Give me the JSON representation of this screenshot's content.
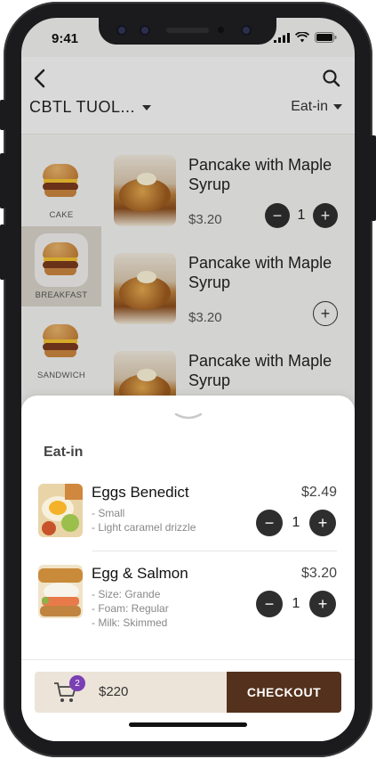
{
  "status": {
    "time": "9:41"
  },
  "header": {
    "store": "CBTL TUOL...",
    "mode": "Eat-in"
  },
  "categories": [
    {
      "label": "CAKE",
      "active": false
    },
    {
      "label": "BREAKFAST",
      "active": true
    },
    {
      "label": "SANDWICH",
      "active": false
    }
  ],
  "menu_items": [
    {
      "name": "Pancake with Maple Syrup",
      "price": "$3.20",
      "quantity": "1"
    },
    {
      "name": "Pancake with Maple Syrup",
      "price": "$3.20",
      "quantity": ""
    },
    {
      "name": "Pancake with Maple Syrup",
      "price": "",
      "quantity": ""
    }
  ],
  "sheet": {
    "title": "Eat-in",
    "items": [
      {
        "name": "Eggs Benedict",
        "price": "$2.49",
        "options": [
          "- Small",
          "- Light caramel drizzle"
        ],
        "quantity": "1"
      },
      {
        "name": "Egg & Salmon",
        "price": "$3.20",
        "options": [
          "- Size: Grande",
          "- Foam: Regular",
          "- Milk: Skimmed"
        ],
        "quantity": "1"
      }
    ]
  },
  "footer": {
    "cart_count": "2",
    "total": "$220",
    "checkout_label": "CHECKOUT"
  },
  "colors": {
    "checkout": "#54311c",
    "badge": "#7a3fb4",
    "active_category": "#d6d2c8"
  }
}
